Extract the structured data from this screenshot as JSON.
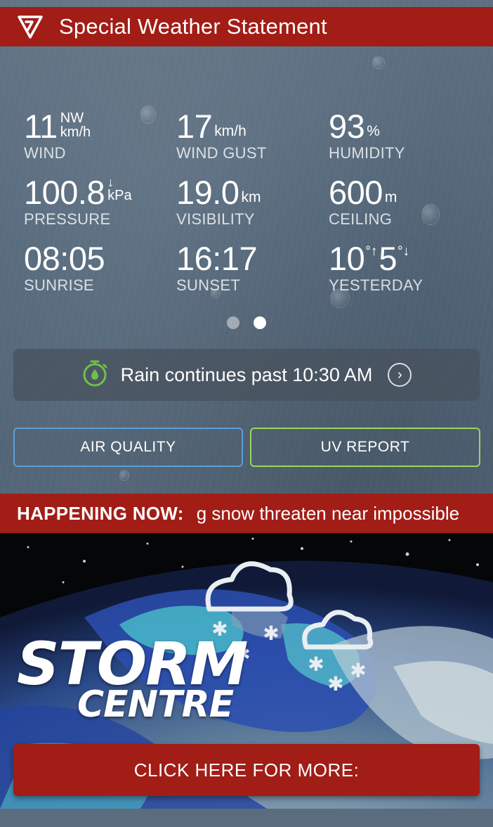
{
  "alert": {
    "title": "Special Weather Statement",
    "icon": "alert-triangle-icon",
    "color": "#a11d16"
  },
  "stats": {
    "wind": {
      "value": "11",
      "direction": "NW",
      "unit": "km/h",
      "label": "WIND"
    },
    "gust": {
      "value": "17",
      "unit": "km/h",
      "label": "WIND GUST"
    },
    "humidity": {
      "value": "93",
      "unit": "%",
      "label": "HUMIDITY"
    },
    "pressure": {
      "value": "100.8",
      "trend": "↓",
      "unit": "kPa",
      "label": "PRESSURE"
    },
    "visibility": {
      "value": "19.0",
      "unit": "km",
      "label": "VISIBILITY"
    },
    "ceiling": {
      "value": "600",
      "unit": "m",
      "label": "CEILING"
    },
    "sunrise": {
      "value": "08:05",
      "label": "SUNRISE"
    },
    "sunset": {
      "value": "16:17",
      "label": "SUNSET"
    },
    "yesterday": {
      "high": "10",
      "high_mark": "°↑",
      "low": "5",
      "low_mark": "°↓",
      "label": "YESTERDAY"
    }
  },
  "pager": {
    "count": 2,
    "active": 1
  },
  "forecast": {
    "text": "Rain continues past 10:30 AM",
    "icon": "stopwatch-icon",
    "icon_color": "#6dc04a"
  },
  "buttons": {
    "air_quality": "AIR QUALITY",
    "uv_report": "UV REPORT",
    "air_color": "#5a9fd8",
    "uv_color": "#9cd65a"
  },
  "happening": {
    "label": "HAPPENING NOW:",
    "text": "g snow threaten near impossible"
  },
  "storm": {
    "title_line1": "STORM",
    "title_line2": "CENTRE",
    "cta": "CLICK HERE FOR MORE:"
  }
}
